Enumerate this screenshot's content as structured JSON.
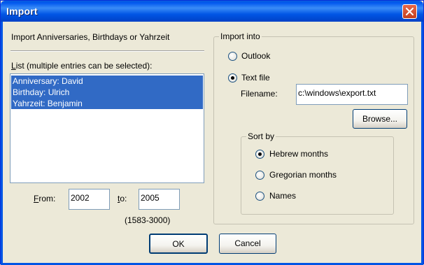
{
  "window": {
    "title": "Import"
  },
  "left": {
    "heading": "Import Anniversaries, Birthdays or Yahrzeit",
    "list_label_hotkey": "L",
    "list_label_rest": "ist (multiple entries can be selected):",
    "list_items": [
      "Anniversary: David",
      "Birthday: Ulrich",
      "Yahrzeit: Benjamin"
    ],
    "from_label_hotkey": "F",
    "from_label_rest": "rom:",
    "from_value": "2002",
    "to_label_hotkey": "t",
    "to_label_rest": "o:",
    "to_value": "2005",
    "range_note": "(1583-3000)"
  },
  "import_into": {
    "label": "Import into",
    "outlook_label": "Outlook",
    "textfile_label": "Text file",
    "selected": "Text file",
    "filename_label": "Filename:",
    "filename_value": "c:\\windows\\export.txt",
    "browse_label": "Browse..."
  },
  "sort_by": {
    "label": "Sort by",
    "options": [
      "Hebrew months",
      "Gregorian months",
      "Names"
    ],
    "selected": "Hebrew months"
  },
  "footer": {
    "ok_label": "OK",
    "cancel_label": "Cancel"
  },
  "colors": {
    "title_bar": "#0055E5",
    "selection": "#316AC5",
    "dialog_bg": "#ECE9D8",
    "close_button": "#D7522D"
  }
}
